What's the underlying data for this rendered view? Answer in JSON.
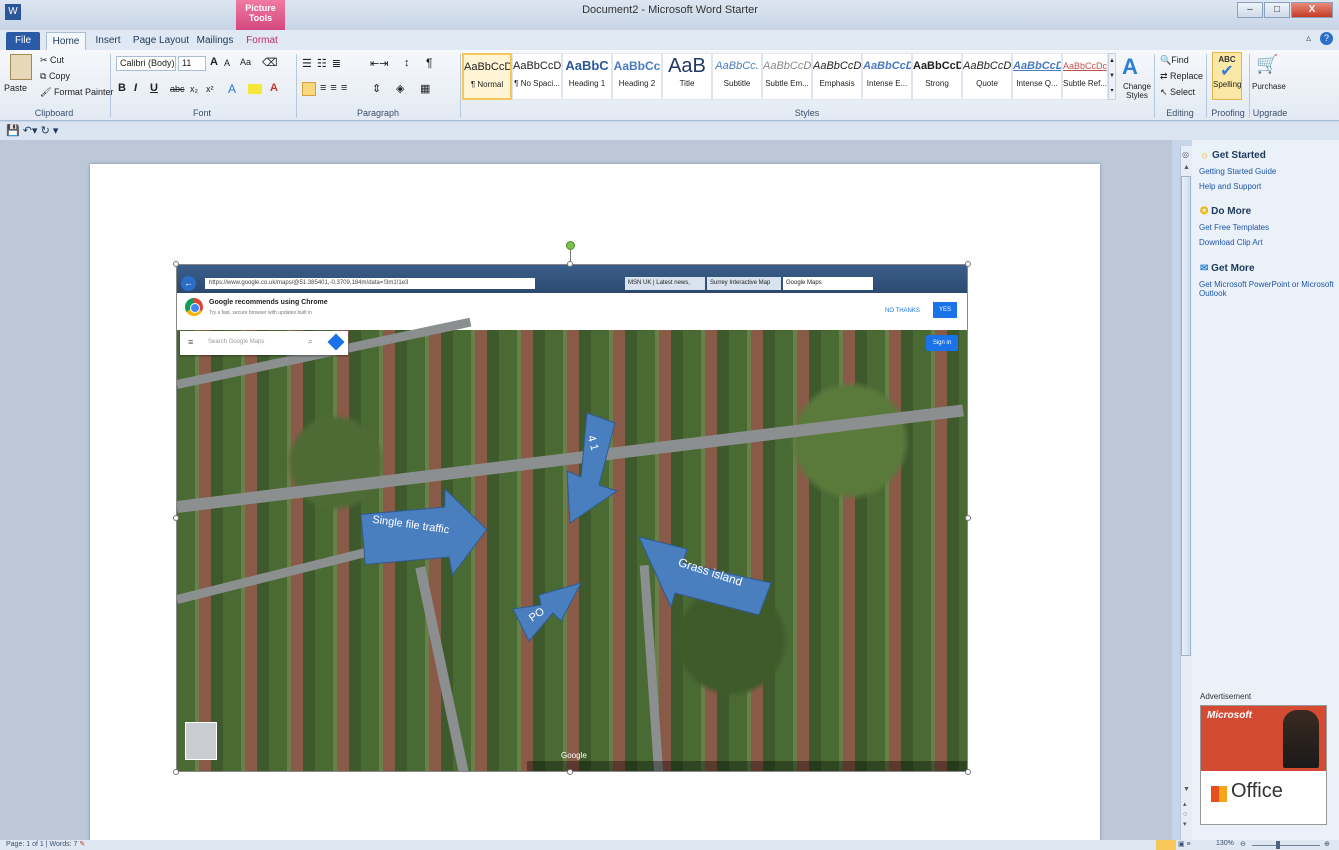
{
  "window": {
    "title": "Document2 - Microsoft Word Starter",
    "context_tab": "Picture Tools",
    "min": "–",
    "max": "□",
    "close": "X"
  },
  "tabs": [
    "File",
    "Home",
    "Insert",
    "Page Layout",
    "Mailings",
    "Format"
  ],
  "clipboard": {
    "paste": "Paste",
    "cut": "Cut",
    "copy": "Copy",
    "format_painter": "Format Painter",
    "label": "Clipboard"
  },
  "font": {
    "name": "Calibri (Body)",
    "size": "11",
    "label": "Font",
    "bold": "B",
    "italic": "I",
    "underline": "U",
    "strike": "abc",
    "sub": "x₂",
    "sup": "x²",
    "grow": "A",
    "shrink": "A",
    "case": "Aa"
  },
  "paragraph": {
    "label": "Paragraph",
    "pilcrow": "¶"
  },
  "styles": {
    "label": "Styles",
    "change": "Change Styles",
    "items": [
      {
        "sample": "AaBbCcDc",
        "name": "¶ Normal"
      },
      {
        "sample": "AaBbCcDc",
        "name": "¶ No Spaci..."
      },
      {
        "sample": "AaBbC",
        "name": "Heading 1"
      },
      {
        "sample": "AaBbCc",
        "name": "Heading 2"
      },
      {
        "sample": "AaB",
        "name": "Title"
      },
      {
        "sample": "AaBbCc.",
        "name": "Subtitle"
      },
      {
        "sample": "AaBbCcDc",
        "name": "Subtle Em..."
      },
      {
        "sample": "AaBbCcDc",
        "name": "Emphasis"
      },
      {
        "sample": "AaBbCcDc",
        "name": "Intense E..."
      },
      {
        "sample": "AaBbCcDc",
        "name": "Strong"
      },
      {
        "sample": "AaBbCcDc",
        "name": "Quote"
      },
      {
        "sample": "AaBbCcDc",
        "name": "Intense Q..."
      },
      {
        "sample": "AaBbCcDc",
        "name": "Subtle Ref..."
      }
    ]
  },
  "editing": {
    "label": "Editing",
    "find": "Find",
    "replace": "Replace",
    "select": "Select"
  },
  "proofing": {
    "label": "Proofing",
    "spelling": "Spelling"
  },
  "upgrade": {
    "label": "Upgrade",
    "purchase": "Purchase"
  },
  "browser": {
    "url": "https://www.google.co.uk/maps/@51.385401,-0.3709,184m/data=!3m1!1e3",
    "tab1": "MSN UK | Latest news, Hotmail,...",
    "tab2": "Surrey Interactive Map",
    "tab3": "Google Maps"
  },
  "chrome_prompt": {
    "title": "Google recommends using Chrome",
    "subtitle": "Try a fast, secure browser with updates built in",
    "no_thanks": "NO THANKS",
    "yes": "YES"
  },
  "maps": {
    "search_placeholder": "Search Google Maps",
    "sign_in": "Sign in",
    "google": "Google"
  },
  "annotations": {
    "single_file": "Single file traffic",
    "grass_island": "Grass island",
    "po": "PO",
    "number_41": "4 1"
  },
  "sidepane": {
    "get_started": "Get Started",
    "getting_started_guide": "Getting Started Guide",
    "help_support": "Help and Support",
    "do_more": "Do More",
    "free_templates": "Get Free Templates",
    "clip_art": "Download Clip Art",
    "get_more": "Get More",
    "get_ms": "Get Microsoft PowerPoint or Microsoft Outlook",
    "advertisement": "Advertisement",
    "ad_brand": "Office",
    "ad_microsoft": "Microsoft"
  },
  "status": {
    "page": "Page: 1 of 1",
    "words": "Words: 7",
    "zoom": "130%"
  }
}
